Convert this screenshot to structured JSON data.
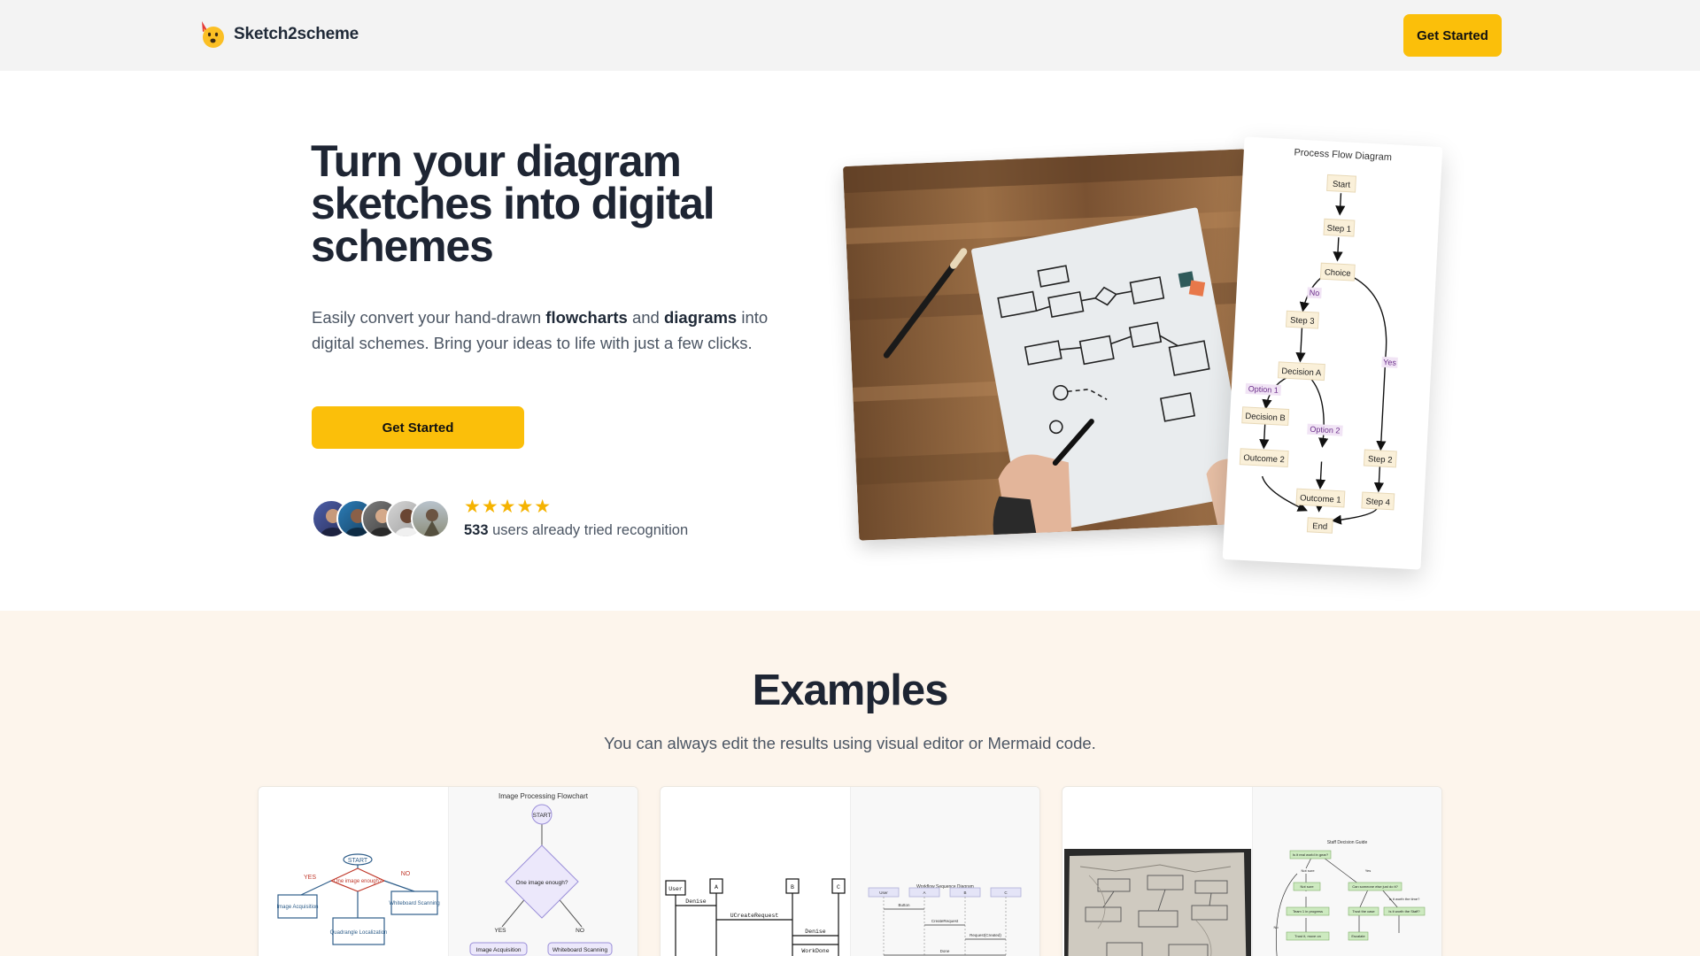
{
  "header": {
    "brand": "Sketch2scheme",
    "cta_label": "Get Started"
  },
  "hero": {
    "title": "Turn your diagram sketches into digital schemes",
    "description": {
      "part1": "Easily convert your hand-drawn ",
      "bold1": "flowcharts",
      "part2": " and ",
      "bold2": "diagrams",
      "part3": " into digital schemes. Bring your ideas to life with just a few clicks."
    },
    "cta_label": "Get Started",
    "rating": {
      "stars": "★★★★★",
      "count": "533",
      "suffix": " users already tried recognition"
    }
  },
  "flow_diagram": {
    "title": "Process Flow Diagram",
    "nodes": {
      "start": "Start",
      "step1": "Step 1",
      "choice": "Choice",
      "step3": "Step 3",
      "decisionA": "Decision A",
      "decisionB": "Decision B",
      "outcome2": "Outcome 2",
      "outcome1": "Outcome 1",
      "step2": "Step 2",
      "step4": "Step 4",
      "end": "End"
    },
    "edge_labels": {
      "no": "No",
      "yes": "Yes",
      "option1": "Option 1",
      "option2": "Option 2"
    }
  },
  "examples": {
    "title": "Examples",
    "subtitle": "You can always edit the results using visual editor or Mermaid code.",
    "cards": [
      {
        "caption": "Image Processing Flowchart",
        "sketch_labels": [
          "START",
          "One image enough?",
          "YES",
          "NO",
          "Image Acquisition",
          "Whiteboard Scanning",
          "Quadrangle Localization"
        ],
        "digital_labels": [
          "START",
          "One image enough?",
          "YES",
          "NO",
          "Image Acquisition",
          "Whiteboard Scanning"
        ]
      },
      {
        "caption": "Workflow Sequence Diagram",
        "sketch_labels": [
          "User",
          "A",
          "B",
          "C",
          "Denise",
          "UCreateRequest",
          "Denise",
          "WorkDone"
        ],
        "digital_labels": [
          "User",
          "A",
          "B",
          "C",
          "Button",
          "CreateRequest",
          "Request(Created)",
          "Done"
        ]
      },
      {
        "caption": "Staff Decision Guide",
        "digital_labels": [
          "Is it real world in gear?",
          "Not sure",
          "Yes",
          "No",
          "Not sure",
          "Can someone else just do it?",
          "Is it worth the time?",
          "Team 1 in progress",
          "Trust the case",
          "Is it worth the Staff?",
          "Trust it, move on",
          "Escalate"
        ]
      }
    ]
  }
}
